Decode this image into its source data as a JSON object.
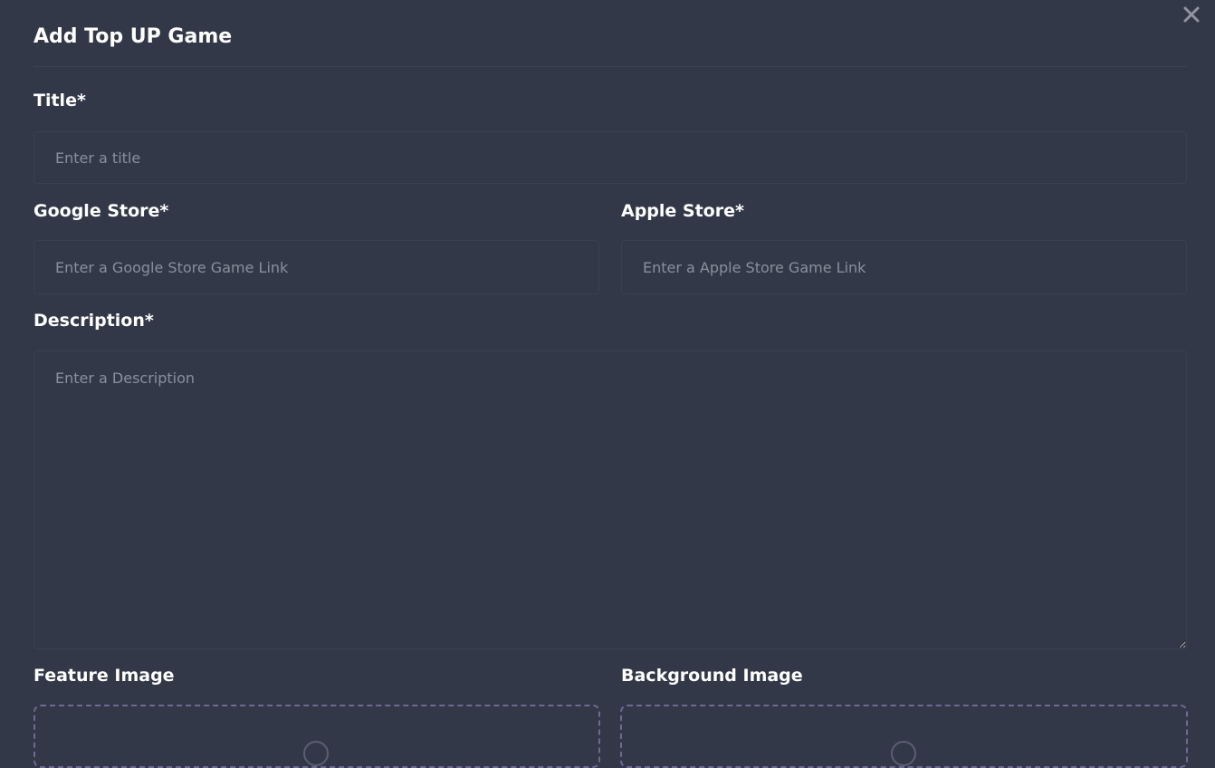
{
  "dialog": {
    "title": "Add Top UP Game",
    "close_icon": "close-icon"
  },
  "form": {
    "title": {
      "label": "Title*",
      "placeholder": "Enter a title",
      "value": ""
    },
    "google_store": {
      "label": "Google Store*",
      "placeholder": "Enter a Google Store Game Link",
      "value": ""
    },
    "apple_store": {
      "label": "Apple Store*",
      "placeholder": "Enter a Apple Store Game Link",
      "value": ""
    },
    "description": {
      "label": "Description*",
      "placeholder": "Enter a Description",
      "value": ""
    },
    "feature_image": {
      "label": "Feature Image",
      "icon": "upload-icon"
    },
    "background_image": {
      "label": "Background Image",
      "icon": "upload-icon"
    }
  },
  "colors": {
    "background": "#323847",
    "border": "#3a4050",
    "dashed_border": "#6e6a92",
    "placeholder": "#8a8f9c",
    "text": "#ffffff"
  }
}
